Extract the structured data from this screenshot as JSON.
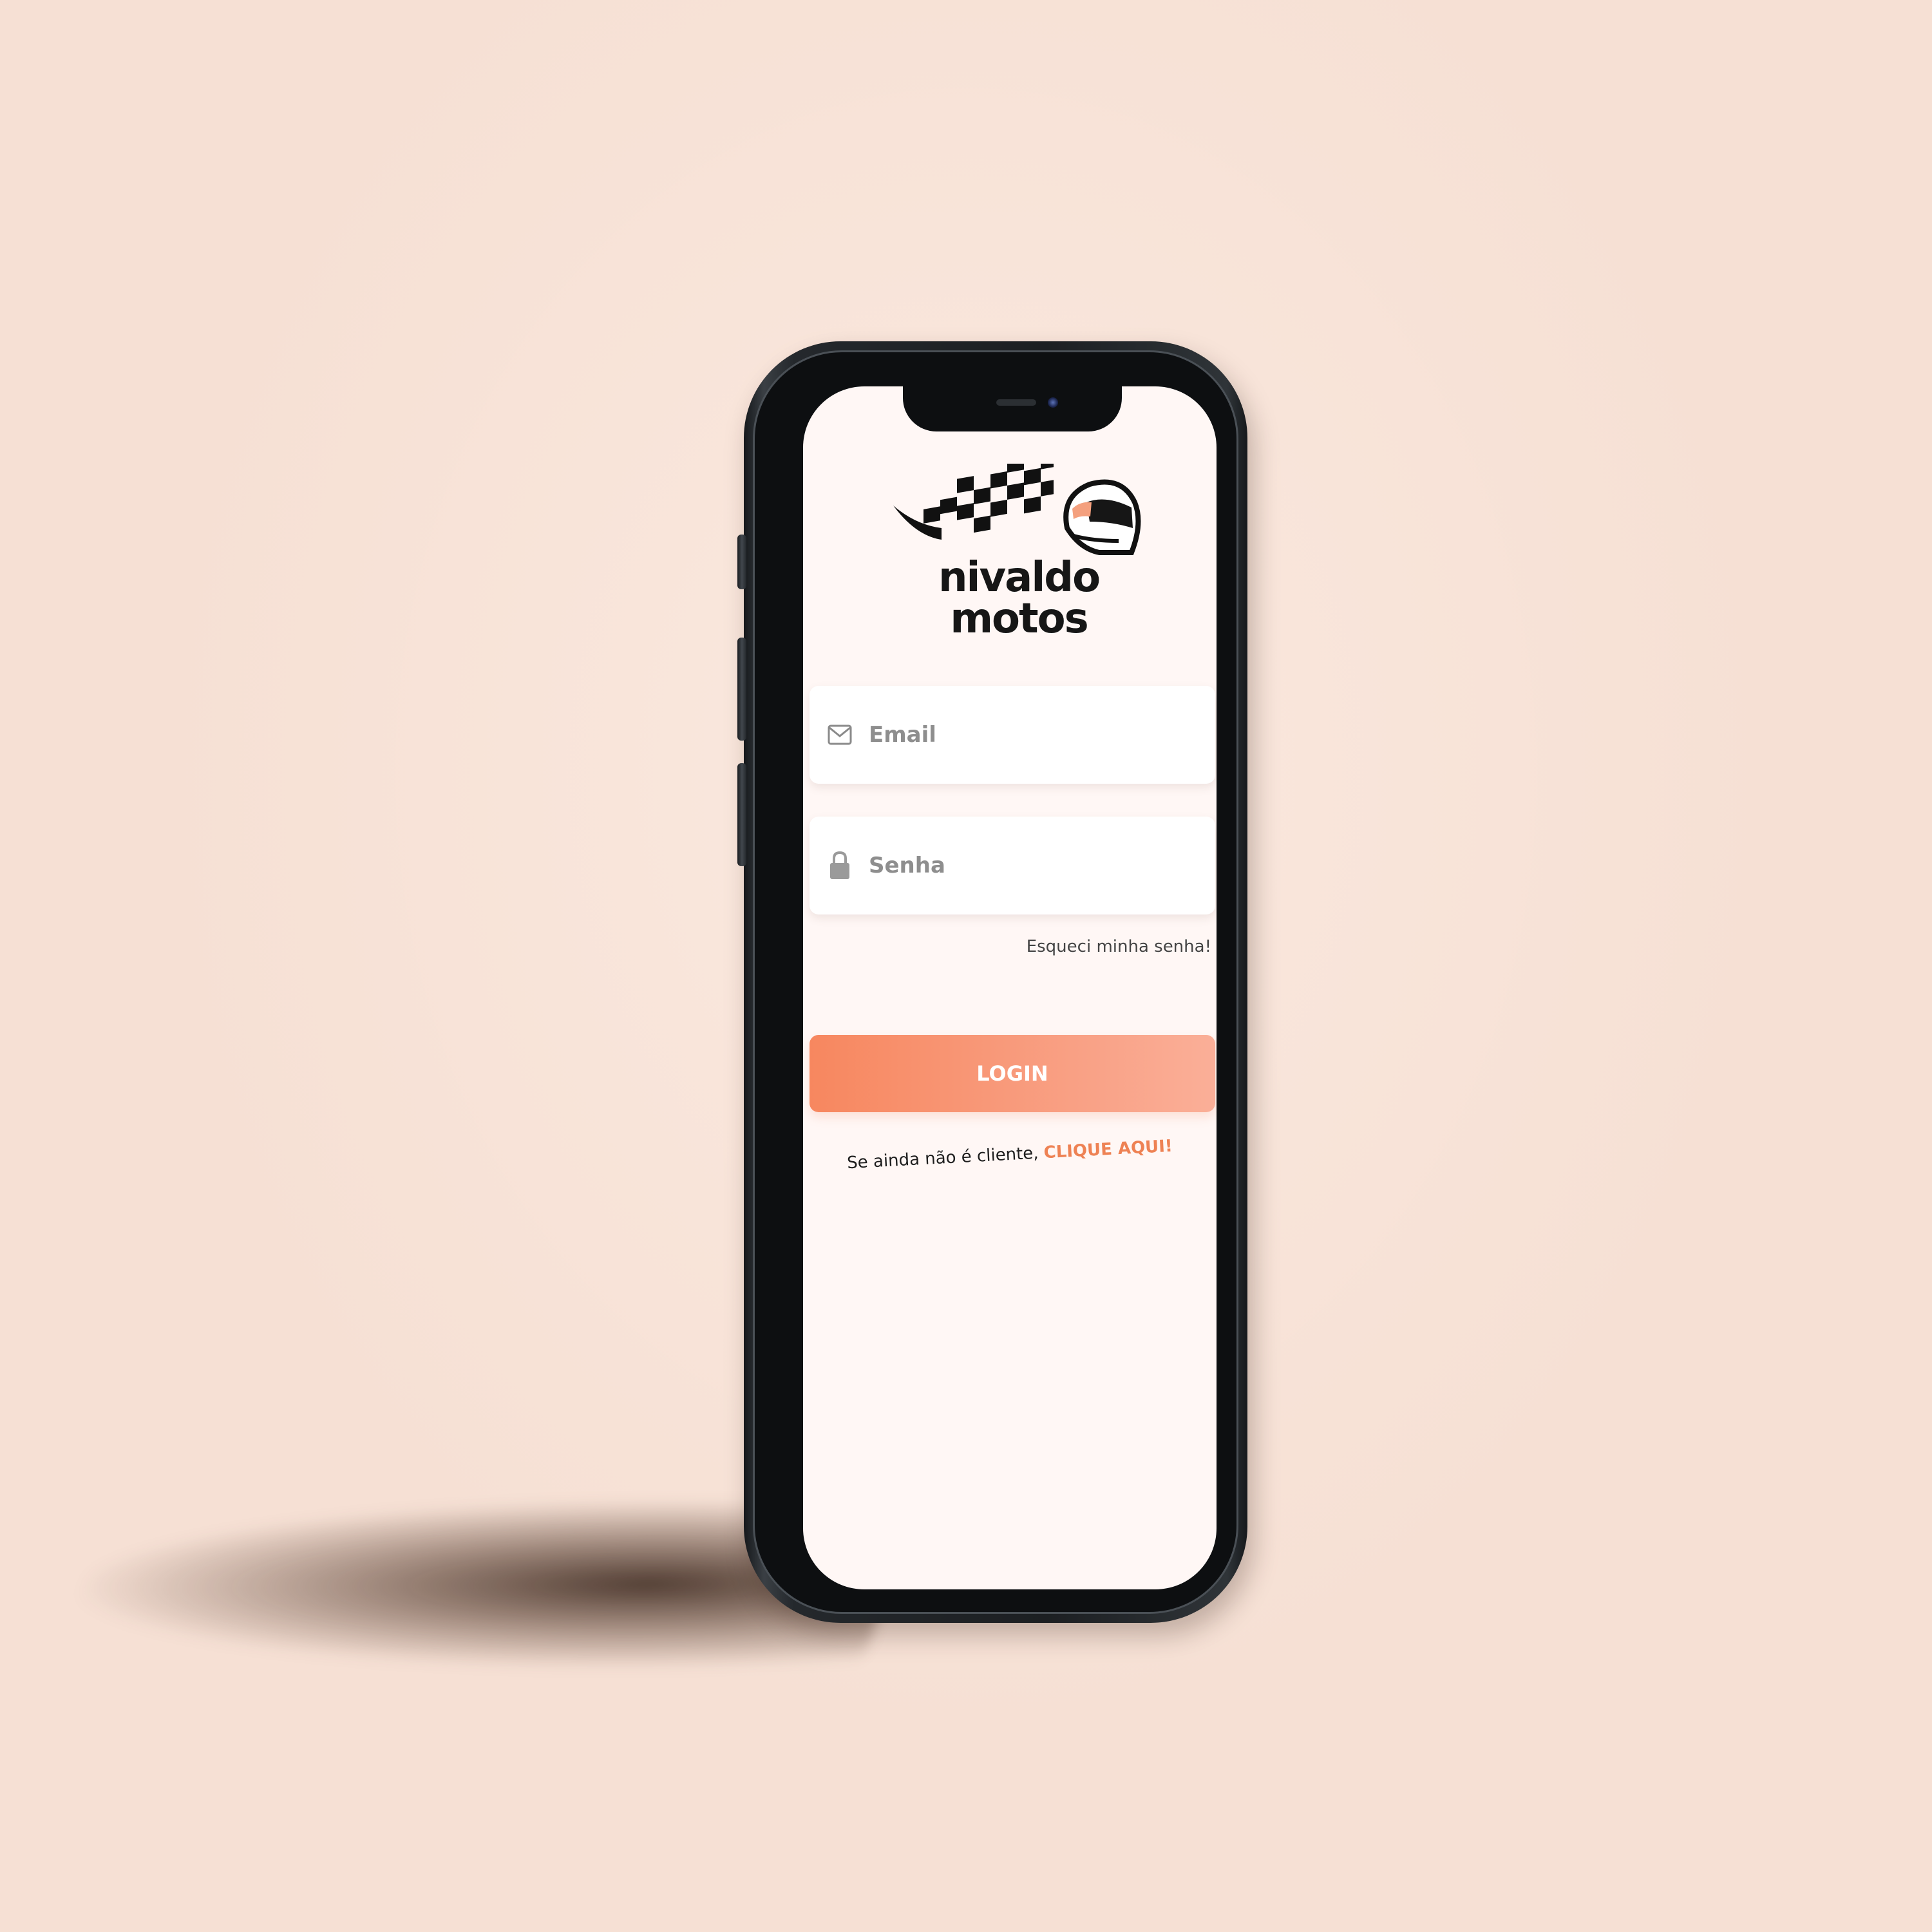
{
  "brand": {
    "name": "nivaldo motos",
    "logo_icon": "checkered-flag-helmet-icon",
    "wordmark_color": "#161616",
    "accent_color": "#f7875f"
  },
  "login_form": {
    "email": {
      "icon": "envelope-icon",
      "placeholder": "Email",
      "value": ""
    },
    "password": {
      "icon": "lock-icon",
      "placeholder": "Senha",
      "value": ""
    },
    "forgot_password_label": "Esqueci minha senha!",
    "login_button_label": "LOGIN",
    "signup_prompt": "Se ainda não é cliente,",
    "signup_link_label": "CLIQUE AQUI!"
  },
  "colors": {
    "background": "#f6e0d4",
    "screen": "#fff7f5",
    "button_gradient_start": "#f7875f",
    "button_gradient_end": "#faaf98",
    "link": "#ee8254",
    "phone_frame": "#1c1f22"
  }
}
